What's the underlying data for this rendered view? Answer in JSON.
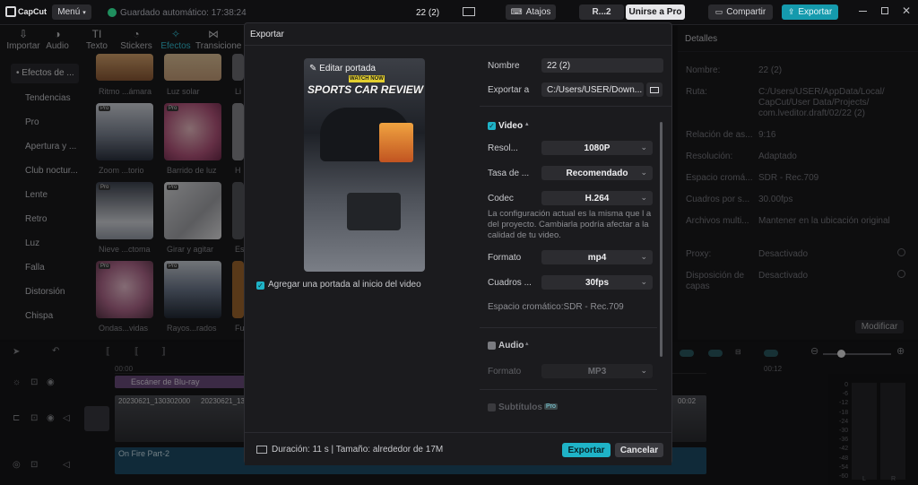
{
  "app": {
    "logo": "CapCut",
    "menu_label": "Menú",
    "autosave": "Guardado automático: 17:38:24",
    "project_title": "22 (2)",
    "shortcuts_label": "Atajos",
    "profile_label": "R...2",
    "pro_label": "Unirse a Pro",
    "share_label": "Compartir",
    "export_label": "Exportar"
  },
  "library": {
    "tabs": [
      {
        "label": "Importar",
        "icon": "import-icon",
        "glyph": "⇩"
      },
      {
        "label": "Audio",
        "icon": "audio-icon",
        "glyph": "◑"
      },
      {
        "label": "Texto",
        "icon": "text-icon",
        "glyph": "TI"
      },
      {
        "label": "Stickers",
        "icon": "sticker-icon",
        "glyph": "◔"
      },
      {
        "label": "Efectos",
        "icon": "effects-icon",
        "glyph": "✧"
      },
      {
        "label": "Transicione",
        "icon": "transition-icon",
        "glyph": "⋈"
      }
    ],
    "categories": [
      "• Efectos de ...",
      "Tendencias",
      "Pro",
      "Apertura y ...",
      "Club noctur...",
      "Lente",
      "Retro",
      "Luz",
      "Falla",
      "Distorsión",
      "Chispa"
    ],
    "thumbs": [
      {
        "label": "Ritmo ...ámara"
      },
      {
        "label": "Luz solar"
      },
      {
        "label": "Li"
      },
      {
        "label": "Zoom ...torio"
      },
      {
        "label": "Barrido de luz"
      },
      {
        "label": "H"
      },
      {
        "label": "Nieve ...ctoma"
      },
      {
        "label": "Girar y agitar"
      },
      {
        "label": "Es"
      },
      {
        "label": "Ondas...vidas"
      },
      {
        "label": "Rayos...rados"
      },
      {
        "label": "Fu"
      }
    ],
    "pro_badge": "Pro"
  },
  "details": {
    "title": "Detalles",
    "rows": [
      {
        "label": "Nombre:",
        "value": "22 (2)"
      },
      {
        "label": "Ruta:",
        "value": "C:/Users/USER/AppData/Local/"
      },
      {
        "label": "",
        "value": "CapCut/User Data/Projects/"
      },
      {
        "label": "",
        "value": "com.lveditor.draft/02/22 (2)"
      },
      {
        "label": "Relación de as...",
        "value": "9:16"
      },
      {
        "label": "Resolución:",
        "value": "Adaptado"
      },
      {
        "label": "Espacio cromá...",
        "value": "SDR - Rec.709"
      },
      {
        "label": "Cuadros por s...",
        "value": "30.00fps"
      },
      {
        "label": "Archivos multi...",
        "value": "Mantener en la ubicación original"
      },
      {
        "label": "Proxy:",
        "value": "Desactivado"
      },
      {
        "label": "Disposición de",
        "value": "Desactivado"
      },
      {
        "label": "capas",
        "value": ""
      }
    ],
    "modify_label": "Modificar"
  },
  "timeline": {
    "time_00": "00:00",
    "time_12": "00:12",
    "time_end": "00:02",
    "track_bluray": "Escáner de Blu-ray",
    "clip1": "20230621_130302000",
    "clip2": "20230621_13",
    "audio_clip": "On Fire Part-2",
    "meter_ticks": [
      "0",
      "-6",
      "-12",
      "-18",
      "-24",
      "-30",
      "-36",
      "-42",
      "-48",
      "-54",
      "-60"
    ],
    "meter_lr": [
      "L",
      "R"
    ]
  },
  "dialog": {
    "title": "Exportar",
    "cover_edit": "Editar portada",
    "cover_badge": "WATCH NOW",
    "cover_headline": "SPORTS CAR REVIEW",
    "cover_checkbox": "Agregar una portada al inicio del video",
    "name_label": "Nombre",
    "name_value": "22 (2)",
    "export_to_label": "Exportar a",
    "export_to_value": "C:/Users/USER/Down...",
    "video_section": "Video",
    "resolution_label": "Resol...",
    "resolution_value": "1080P",
    "bitrate_label": "Tasa de ...",
    "bitrate_value": "Recomendado",
    "codec_label": "Codec",
    "codec_value": "H.264",
    "notice": "La configuración actual es la misma que l a del proyecto. Cambiarla podría afectar a la calidad de tu video.",
    "format_label": "Formato",
    "format_value": "mp4",
    "fps_label": "Cuadros ...",
    "fps_value": "30fps",
    "colorspace": "Espacio cromático:SDR - Rec.709",
    "audio_section": "Audio",
    "audio_format_label": "Formato",
    "audio_format_value": "MP3",
    "subtitles_section": "Subtítulos",
    "subtitles_badge": "Pro",
    "footer_info": "Duración: 11 s | Tamaño: alrededor de 17M",
    "export_button": "Exportar",
    "cancel_button": "Cancelar"
  },
  "colors": {
    "accent": "#1fb3c7",
    "pro": "#7fd7e6"
  }
}
